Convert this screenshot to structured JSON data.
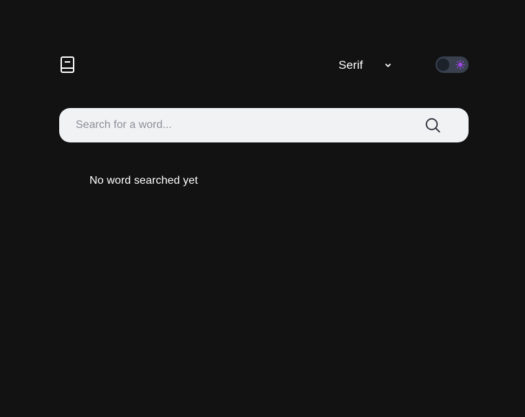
{
  "header": {
    "logo_icon": "book-icon",
    "font_select": {
      "value": "Serif",
      "icon": "chevron-down-icon"
    },
    "theme_toggle": {
      "state": "dark",
      "icon": "sun-icon"
    }
  },
  "search": {
    "placeholder": "Search for a word...",
    "value": "",
    "icon": "search-icon"
  },
  "main": {
    "empty_message": "No word searched yet"
  },
  "colors": {
    "background": "#121212",
    "search_bar_bg": "#f1f2f4",
    "accent": "#a445ed",
    "toggle_track": "#39414f"
  }
}
